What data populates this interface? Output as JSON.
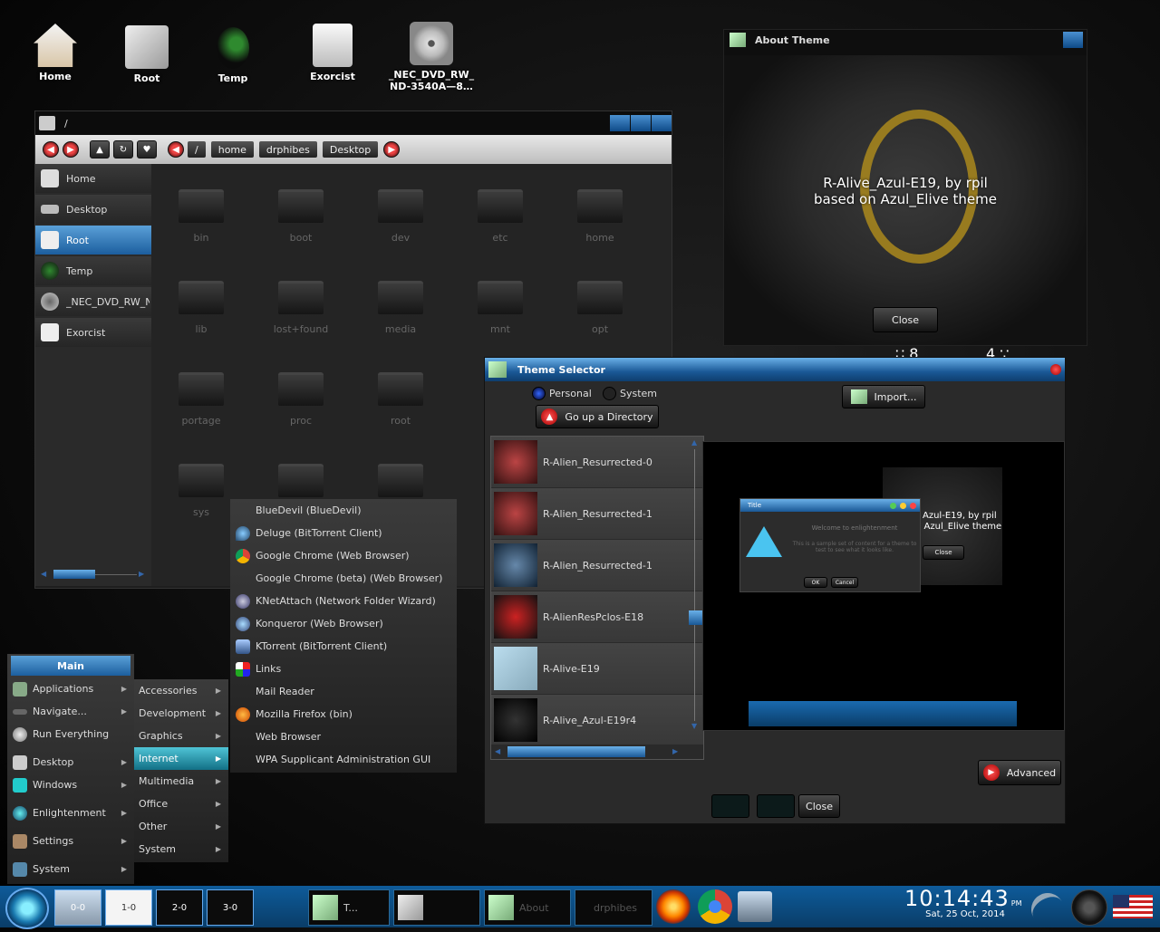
{
  "desktop_icons": [
    {
      "label": "Home",
      "icon": "home-icon"
    },
    {
      "label": "Root",
      "icon": "root-icon"
    },
    {
      "label": "Temp",
      "icon": "temp-icon"
    },
    {
      "label": "Exorcist",
      "icon": "drive-icon"
    },
    {
      "label": "_NEC_DVD_RW_\nND-3540A—8…",
      "icon": "cdrom-icon"
    }
  ],
  "file_manager": {
    "title": "/",
    "crumbs": [
      "/",
      "home",
      "drphibes",
      "Desktop"
    ],
    "sidebar": [
      {
        "label": "Home"
      },
      {
        "label": "Desktop"
      },
      {
        "label": "Root"
      },
      {
        "label": "Temp"
      },
      {
        "label": "_NEC_DVD_RW_N"
      },
      {
        "label": "Exorcist"
      }
    ],
    "folders": [
      "bin",
      "boot",
      "dev",
      "etc",
      "home",
      "lib",
      "lost+found",
      "media",
      "mnt",
      "opt",
      "portage",
      "proc",
      "root",
      "",
      "",
      "sys",
      "",
      "",
      "",
      ""
    ]
  },
  "about": {
    "title": "About Theme",
    "line1": "R-Alive_Azul-E19, by rpil",
    "line2": "based on Azul_Elive theme",
    "close": "Close",
    "clock_fragment_left": "∷ 8",
    "clock_fragment_right": "4 ∵"
  },
  "theme_selector": {
    "title": "Theme Selector",
    "personal": "Personal",
    "system": "System",
    "import": "Import...",
    "go_up": "Go up a Directory",
    "themes": [
      "R-Alien_Resurrected-0",
      "R-Alien_Resurrected-1",
      "R-Alien_Resurrected-1",
      "R-AlienResPclos-E18",
      "R-Alive-E19",
      "R-Alive_Azul-E19r4"
    ],
    "preview": {
      "win_title": "Title",
      "welcome": "Welcome to enlightenment",
      "body": "This is a sample set of content for a theme to test to see what it looks like.",
      "ok": "OK",
      "cancel": "Cancel",
      "about_line1": "Azul-E19, by rpil",
      "about_line2": "n Azul_Elive theme",
      "about_close": "Close"
    },
    "advanced": "Advanced",
    "close": "Close"
  },
  "main_menu": {
    "title": "Main",
    "items": [
      {
        "label": "Applications",
        "icon": "applications-icon"
      },
      {
        "label": "Navigate...",
        "icon": "navigate-icon"
      },
      {
        "label": "Run Everything",
        "icon": "gear-icon"
      },
      {
        "label": "Desktop",
        "icon": "desktop-icon"
      },
      {
        "label": "Windows",
        "icon": "windows-icon"
      },
      {
        "label": "Enlightenment",
        "icon": "enlightenment-icon"
      },
      {
        "label": "Settings",
        "icon": "settings-icon"
      },
      {
        "label": "System",
        "icon": "system-icon"
      }
    ]
  },
  "apps_menu": {
    "items": [
      "Accessories",
      "Development",
      "Graphics",
      "Internet",
      "Multimedia",
      "Office",
      "Other",
      "System"
    ]
  },
  "internet_menu": {
    "items": [
      {
        "label": "BlueDevil (BlueDevil)",
        "icon": ""
      },
      {
        "label": "Deluge (BitTorrent Client)",
        "icon": "deluge-icon"
      },
      {
        "label": "Google Chrome (Web Browser)",
        "icon": "chrome-icon"
      },
      {
        "label": "Google Chrome (beta) (Web Browser)",
        "icon": ""
      },
      {
        "label": "KNetAttach (Network Folder Wizard)",
        "icon": "knetattach-icon"
      },
      {
        "label": "Konqueror (Web Browser)",
        "icon": "konqueror-icon"
      },
      {
        "label": "KTorrent (BitTorrent Client)",
        "icon": "ktorrent-icon"
      },
      {
        "label": "Links",
        "icon": "links-icon"
      },
      {
        "label": "Mail Reader",
        "icon": ""
      },
      {
        "label": "Mozilla Firefox (bin)",
        "icon": "firefox-icon"
      },
      {
        "label": "Web Browser",
        "icon": ""
      },
      {
        "label": "WPA Supplicant Administration GUI",
        "icon": ""
      }
    ]
  },
  "taskbar": {
    "pager": [
      "0-0",
      "1-0",
      "2-0",
      "3-0"
    ],
    "tasks": [
      "T...",
      "",
      "About",
      "drphibes"
    ],
    "clock_time": "10:14:43",
    "clock_ampm": "PM",
    "clock_date": "Sat, 25 Oct, 2014"
  }
}
